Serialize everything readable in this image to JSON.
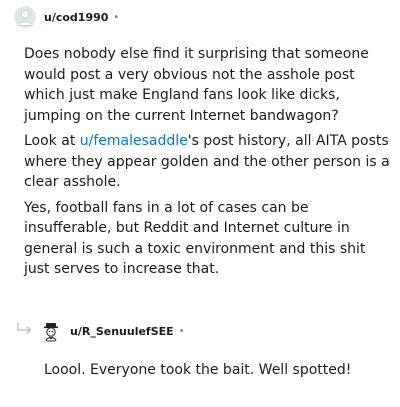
{
  "comment": {
    "author": "u/cod1990",
    "separator": "•",
    "paragraphs": {
      "p1": "Does nobody else find it surprising that someone would post a very obvious not the asshole post which just make England fans look like dicks, jumping on the current Internet bandwagon?",
      "p2_before": "Look at ",
      "p2_link": "u/femalesaddle",
      "p2_after": "'s post history, all AITA posts where they appear golden and the other person is a clear asshole.",
      "p3": "Yes, football fans in a lot of cases can be insufferable, but Reddit and Internet culture in general is such a toxic environment and this shit just serves to increase that."
    }
  },
  "reply": {
    "author": "u/R_SenuulefSEE",
    "separator": "•",
    "body": "Loool. Everyone took the bait. Well spotted!"
  },
  "colors": {
    "text": "#1c1c1c",
    "link": "#0079d3",
    "meta": "#7c7c7c"
  }
}
